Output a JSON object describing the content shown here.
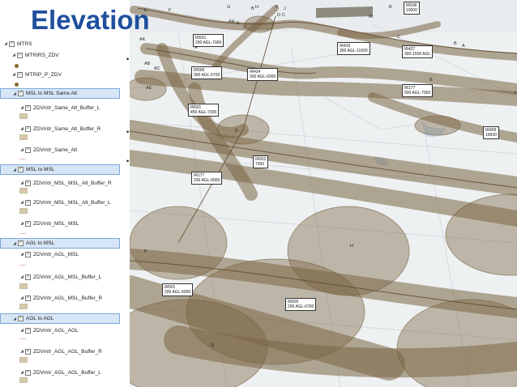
{
  "title": "Elevation",
  "layers": [
    {
      "label": "MTRS",
      "indent": 0,
      "selected": false,
      "tri": true,
      "checked": true
    },
    {
      "label": "MTRIRS_ZDV",
      "indent": 1,
      "selected": false,
      "tri": true,
      "checked": true
    },
    {
      "label": "MTRIP_P_ZDV",
      "indent": 1,
      "selected": false,
      "tri": true,
      "checked": true
    },
    {
      "label": "MSL to MSL Same Alt",
      "indent": 1,
      "selected": true,
      "tri": true,
      "checked": true
    },
    {
      "label": "ZDVmtr_Same_Alt_Buffer_L",
      "indent": 2,
      "selected": false,
      "tri": true,
      "checked": true
    },
    {
      "label": "ZDVmtr_Same_Alt_Buffer_R",
      "indent": 2,
      "selected": false,
      "tri": true,
      "checked": true
    },
    {
      "label": "ZDVmtr_Same_Alt",
      "indent": 2,
      "selected": false,
      "tri": true,
      "checked": true
    },
    {
      "label": "MSL to MSL",
      "indent": 1,
      "selected": true,
      "tri": true,
      "checked": true
    },
    {
      "label": "ZDVmtr_MSL_MSL_Alt_Buffer_R",
      "indent": 2,
      "selected": false,
      "tri": true,
      "checked": true
    },
    {
      "label": "ZDVmtr_MSL_MSL_Alt_Buffer_L",
      "indent": 2,
      "selected": false,
      "tri": true,
      "checked": true
    },
    {
      "label": "ZDVmtr_MSL_MSL",
      "indent": 2,
      "selected": false,
      "tri": true,
      "checked": true
    },
    {
      "label": "AGL to MSL",
      "indent": 1,
      "selected": true,
      "tri": true,
      "checked": true
    },
    {
      "label": "ZDVmtr_AGL_MSL",
      "indent": 2,
      "selected": false,
      "tri": true,
      "checked": true
    },
    {
      "label": "ZDVmtr_AGL_MSL_Buffer_L",
      "indent": 2,
      "selected": false,
      "tri": true,
      "checked": true
    },
    {
      "label": "ZDVmtr_AGL_MSL_Buffer_R",
      "indent": 2,
      "selected": false,
      "tri": true,
      "checked": true
    },
    {
      "label": "AGL to AGL",
      "indent": 1,
      "selected": true,
      "tri": true,
      "checked": true
    },
    {
      "label": "ZDVmtr_AGL_AGL",
      "indent": 2,
      "selected": false,
      "tri": true,
      "checked": true
    },
    {
      "label": "ZDVmtr_AGL_AGL_Buffer_R",
      "indent": 2,
      "selected": false,
      "tri": true,
      "checked": true
    },
    {
      "label": "ZDVmtr_AGL_AGL_Buffer_L",
      "indent": 2,
      "selected": false,
      "tri": true,
      "checked": true
    }
  ],
  "map": {
    "route_color": "#7a6443",
    "route_labels": [
      {
        "id": "ir501_top",
        "lines": [
          "IR501",
          "200 AGL-7000"
        ]
      },
      {
        "id": "ir416",
        "lines": [
          "IR416",
          "300 AGL-11000"
        ]
      },
      {
        "id": "ir427",
        "lines": [
          "IR427",
          "300-1500 AGL"
        ]
      },
      {
        "id": "ir500_a",
        "lines": [
          "IR500",
          "300 AGL-5700"
        ]
      },
      {
        "id": "ir424",
        "lines": [
          "IR424",
          "300 AGL-6000"
        ]
      },
      {
        "id": "ir177_a",
        "lines": [
          "IR177",
          "500 AGL-7000"
        ]
      },
      {
        "id": "ir501_b",
        "lines": [
          "IR501",
          "450 AGL-7000"
        ]
      },
      {
        "id": "ir409",
        "lines": [
          "IR409",
          "10000"
        ]
      },
      {
        "id": "ir501_c",
        "lines": [
          "IR501",
          "7000"
        ]
      },
      {
        "id": "ir177_b",
        "lines": [
          "IR177",
          "200 AGL-6000"
        ]
      },
      {
        "id": "ir501_d",
        "lines": [
          "IR501",
          "200 AGL-6000"
        ]
      },
      {
        "id": "ir500_b",
        "lines": [
          "IR500",
          "200 AGL-6700"
        ]
      },
      {
        "id": "ir508",
        "lines": [
          "IR508",
          "10000"
        ]
      }
    ],
    "point_letters": [
      "E",
      "F",
      "G",
      "H",
      "B",
      "F",
      "J",
      "D",
      "C",
      "AH",
      "E",
      "G",
      "AI",
      "B",
      "AK",
      "AB",
      "AC",
      "E",
      "C",
      "B",
      "A",
      "H",
      "B",
      "A",
      "AE",
      "D",
      "P",
      "Q",
      "H"
    ]
  }
}
